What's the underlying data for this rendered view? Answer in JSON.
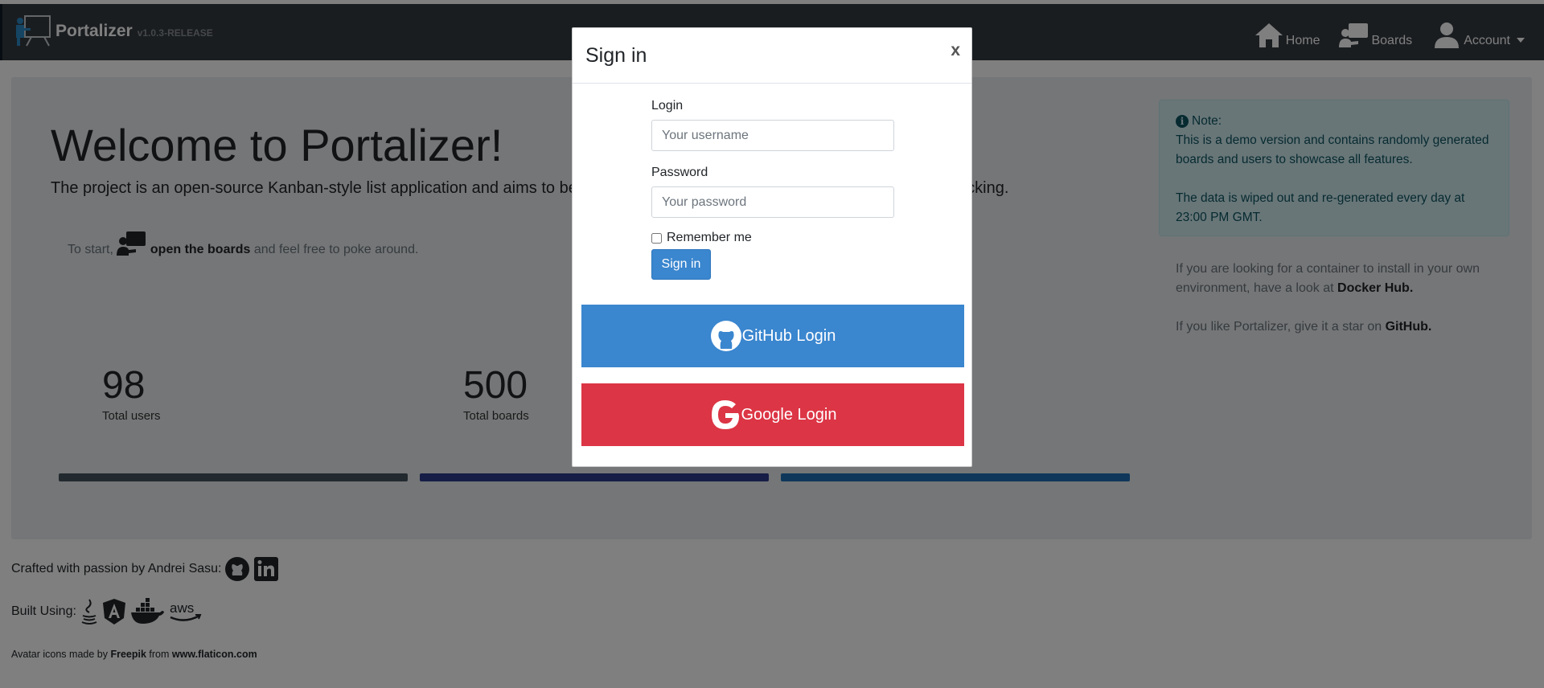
{
  "navbar": {
    "brand": "Portalizer",
    "version": "v1.0.3-RELEASE",
    "items": [
      {
        "label": "Home",
        "icon": "home-icon"
      },
      {
        "label": "Boards",
        "icon": "boards-icon"
      },
      {
        "label": "Account",
        "icon": "user-icon"
      }
    ]
  },
  "main": {
    "title": "Welcome to Portalizer!",
    "lead": "The project is an open-source Kanban-style list application and aims to be",
    "lead_tail": "acking.",
    "start_prefix": "To start,",
    "start_link": "open the boards",
    "start_suffix": "and feel free to poke around.",
    "stats": [
      {
        "value": "98",
        "label": "Total users"
      },
      {
        "value": "500",
        "label": "Total boards"
      }
    ],
    "bar_colors": [
      "#47545e",
      "#2d3a8c",
      "#1f6fb5"
    ]
  },
  "note": {
    "heading": "Note:",
    "line1": "This is a demo version and contains randomly generated boards and users to showcase all features.",
    "line2": "The data is wiped out and re-generated every day at 23:00 PM GMT."
  },
  "side": {
    "docker_text": "If you are looking for a container to install in your own environment, have a look at",
    "docker_link": "Docker Hub.",
    "github_text": "If you like Portalizer, give it a star on",
    "github_link": "GitHub."
  },
  "footer": {
    "crafted": "Crafted with passion by Andrei Sasu:",
    "built": "Built Using:",
    "credit_prefix": "Avatar icons made by",
    "credit_author": "Freepik",
    "credit_mid": "from",
    "credit_site": "www.flaticon.com"
  },
  "modal": {
    "title": "Sign in",
    "close": "x",
    "login_label": "Login",
    "login_placeholder": "Your username",
    "password_label": "Password",
    "password_placeholder": "Your password",
    "remember": "Remember me",
    "signin": "Sign in",
    "github": "GitHub Login",
    "google": "Google Login"
  },
  "colors": {
    "primary": "#3a86cf",
    "danger": "#dc3545",
    "navbar": "#343a40",
    "note_bg": "#d1ecf1"
  }
}
